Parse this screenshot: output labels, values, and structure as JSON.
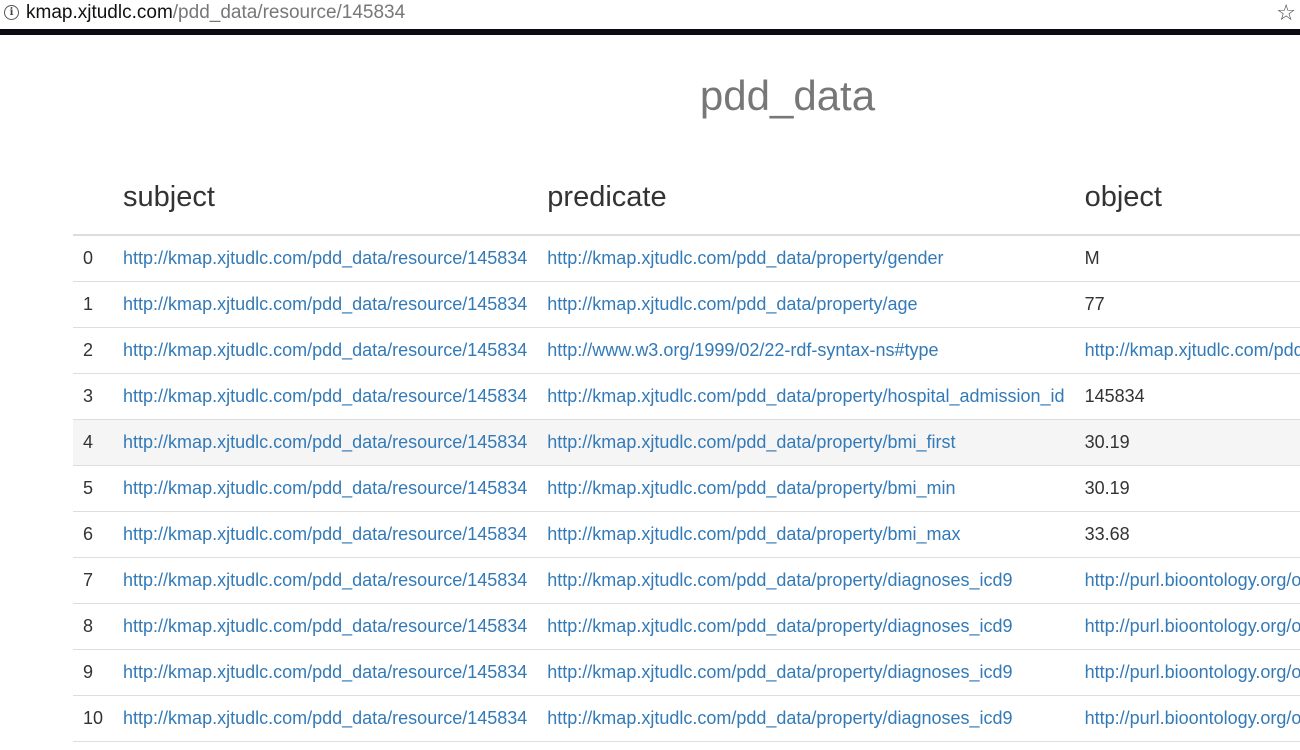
{
  "browser": {
    "url_host": "kmap.xjtudlc.com",
    "url_path": "/pdd_data/resource/145834",
    "info_icon": "i",
    "star_icon": "☆"
  },
  "page": {
    "title": "pdd_data"
  },
  "table": {
    "headers": [
      "",
      "subject",
      "predicate",
      "object"
    ],
    "rows": [
      {
        "index": "0",
        "subject": "http://kmap.xjtudlc.com/pdd_data/resource/145834",
        "predicate": "http://kmap.xjtudlc.com/pdd_data/property/gender",
        "object": "M",
        "object_is_link": false
      },
      {
        "index": "1",
        "subject": "http://kmap.xjtudlc.com/pdd_data/resource/145834",
        "predicate": "http://kmap.xjtudlc.com/pdd_data/property/age",
        "object": "77",
        "object_is_link": false
      },
      {
        "index": "2",
        "subject": "http://kmap.xjtudlc.com/pdd_data/resource/145834",
        "predicate": "http://www.w3.org/1999/02/22-rdf-syntax-ns#type",
        "object": "http://kmap.xjtudlc.com/pdd_da",
        "object_is_link": true
      },
      {
        "index": "3",
        "subject": "http://kmap.xjtudlc.com/pdd_data/resource/145834",
        "predicate": "http://kmap.xjtudlc.com/pdd_data/property/hospital_admission_id",
        "object": "145834",
        "object_is_link": false
      },
      {
        "index": "4",
        "subject": "http://kmap.xjtudlc.com/pdd_data/resource/145834",
        "predicate": "http://kmap.xjtudlc.com/pdd_data/property/bmi_first",
        "object": "30.19",
        "object_is_link": false,
        "highlighted": true
      },
      {
        "index": "5",
        "subject": "http://kmap.xjtudlc.com/pdd_data/resource/145834",
        "predicate": "http://kmap.xjtudlc.com/pdd_data/property/bmi_min",
        "object": "30.19",
        "object_is_link": false
      },
      {
        "index": "6",
        "subject": "http://kmap.xjtudlc.com/pdd_data/resource/145834",
        "predicate": "http://kmap.xjtudlc.com/pdd_data/property/bmi_max",
        "object": "33.68",
        "object_is_link": false
      },
      {
        "index": "7",
        "subject": "http://kmap.xjtudlc.com/pdd_data/resource/145834",
        "predicate": "http://kmap.xjtudlc.com/pdd_data/property/diagnoses_icd9",
        "object": "http://purl.bioontology.org/ontol",
        "object_is_link": true
      },
      {
        "index": "8",
        "subject": "http://kmap.xjtudlc.com/pdd_data/resource/145834",
        "predicate": "http://kmap.xjtudlc.com/pdd_data/property/diagnoses_icd9",
        "object": "http://purl.bioontology.org/ontol",
        "object_is_link": true
      },
      {
        "index": "9",
        "subject": "http://kmap.xjtudlc.com/pdd_data/resource/145834",
        "predicate": "http://kmap.xjtudlc.com/pdd_data/property/diagnoses_icd9",
        "object": "http://purl.bioontology.org/ontol",
        "object_is_link": true
      },
      {
        "index": "10",
        "subject": "http://kmap.xjtudlc.com/pdd_data/resource/145834",
        "predicate": "http://kmap.xjtudlc.com/pdd_data/property/diagnoses_icd9",
        "object": "http://purl.bioontology.org/ontol",
        "object_is_link": true
      }
    ]
  },
  "colors": {
    "link": "#337ab7",
    "title": "#777777",
    "text": "#333333",
    "row_highlight": "#f5f5f5",
    "border": "#dddddd"
  }
}
